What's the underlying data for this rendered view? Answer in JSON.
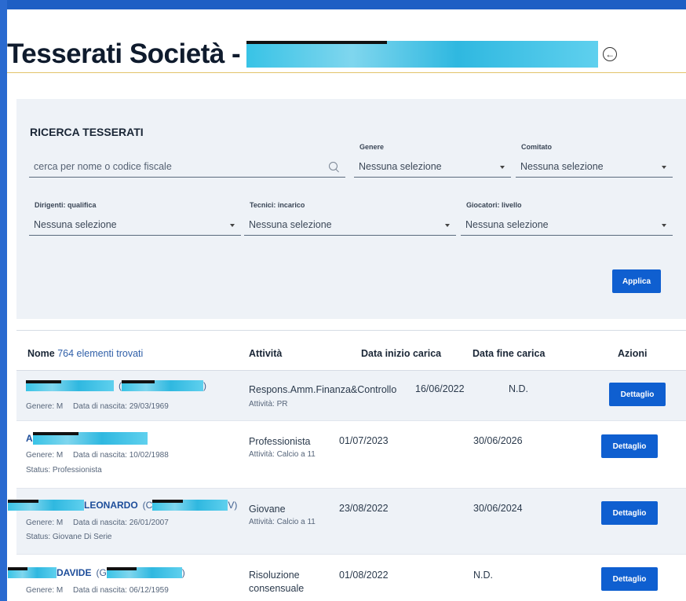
{
  "page": {
    "title": "Tesserati Società -",
    "back_icon": "circle-arrow-left-icon",
    "accent_color": "#1e5fc4"
  },
  "search": {
    "heading": "RICERCA TESSERATI",
    "query_placeholder": "cerca per nome o codice fiscale",
    "genere_label": "Genere",
    "genere_value": "Nessuna selezione",
    "comitato_label": "Comitato",
    "comitato_value": "Nessuna selezione",
    "dirigenti_label": "Dirigenti: qualifica",
    "dirigenti_value": "Nessuna selezione",
    "tecnici_label": "Tecnici: incarico",
    "tecnici_value": "Nessuna selezione",
    "giocatori_label": "Giocatori: livello",
    "giocatori_value": "Nessuna selezione",
    "apply_label": "Applica"
  },
  "table": {
    "col_nome": "Nome",
    "count_text": "764 elementi trovati",
    "col_attivita": "Attività",
    "col_inizio": "Data inizio carica",
    "col_fine": "Data fine carica",
    "col_azioni": "Azioni",
    "rows": [
      {
        "name": "",
        "code_open": "(",
        "code_close": ")",
        "genere": "Genere: M",
        "nascita": "Data di nascita: 29/03/1969",
        "status": "",
        "activity": "Respons.Amm.Finanza&Controllo",
        "activity_sub": "Attività: PR",
        "start": "16/06/2022",
        "end": "N.D.",
        "action": "Dettaglio"
      },
      {
        "name": "A",
        "code_open": "",
        "code_close": "",
        "genere": "Genere: M",
        "nascita": "Data di nascita: 10/02/1988",
        "status": "Status: Professionista",
        "activity": "Professionista",
        "activity_sub": "Attività: Calcio a 11",
        "start": "01/07/2023",
        "end": "30/06/2026",
        "action": "Dettaglio"
      },
      {
        "name": "LEONARDO",
        "code_open": "(C",
        "code_close": "V)",
        "genere": "Genere: M",
        "nascita": "Data di nascita: 26/01/2007",
        "status": "Status: Giovane Di Serie",
        "activity": "Giovane",
        "activity_sub": "Attività: Calcio a 11",
        "start": "23/08/2022",
        "end": "30/06/2024",
        "action": "Dettaglio"
      },
      {
        "name": "DAVIDE",
        "code_open": "(G",
        "code_close": ")",
        "genere": "Genere: M",
        "nascita": "Data di nascita: 06/12/1959",
        "status": "",
        "activity": "Risoluzione consensuale",
        "activity_sub": "",
        "start": "01/08/2022",
        "end": "N.D.",
        "action": "Dettaglio"
      }
    ]
  }
}
